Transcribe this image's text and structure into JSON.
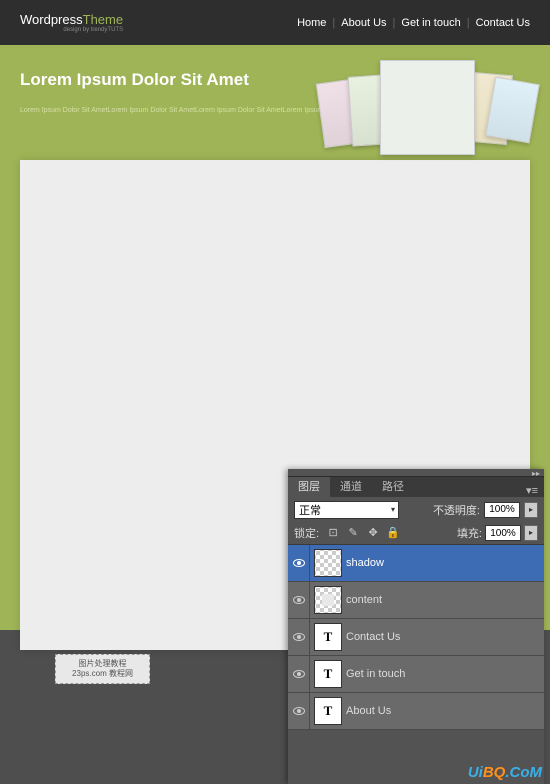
{
  "header": {
    "logo_word1": "Wordpress",
    "logo_word2": "Theme",
    "tagline": "design by trendyTUTS",
    "nav": [
      "Home",
      "About Us",
      "Get in touch",
      "Contact Us"
    ]
  },
  "hero": {
    "title": "Lorem Ipsum Dolor Sit Amet",
    "body": "Lorem Ipsum Dolor Sit AmetLorem Ipsum Dolor Sit\nAmetLorem Ipsum Dolor Sit AmetLorem Ipsum Dolor Sit\nAmetLorem Ipsum Dolor Sit Amet"
  },
  "watermark": {
    "line1": "图片处理教程",
    "line2": "23ps.com 教程网"
  },
  "layers_panel": {
    "tabs": [
      "图层",
      "通道",
      "路径"
    ],
    "blend_mode": "正常",
    "opacity_label": "不透明度:",
    "opacity_value": "100%",
    "lock_label": "锁定:",
    "fill_label": "填充:",
    "fill_value": "100%",
    "layers": [
      {
        "name": "shadow",
        "type": "raster",
        "selected": true
      },
      {
        "name": "content",
        "type": "raster",
        "selected": false
      },
      {
        "name": "Contact Us",
        "type": "text",
        "selected": false
      },
      {
        "name": "Get in touch",
        "type": "text",
        "selected": false
      },
      {
        "name": "About Us",
        "type": "text",
        "selected": false
      }
    ]
  },
  "bottom_brand": "UiBQ.CoM"
}
